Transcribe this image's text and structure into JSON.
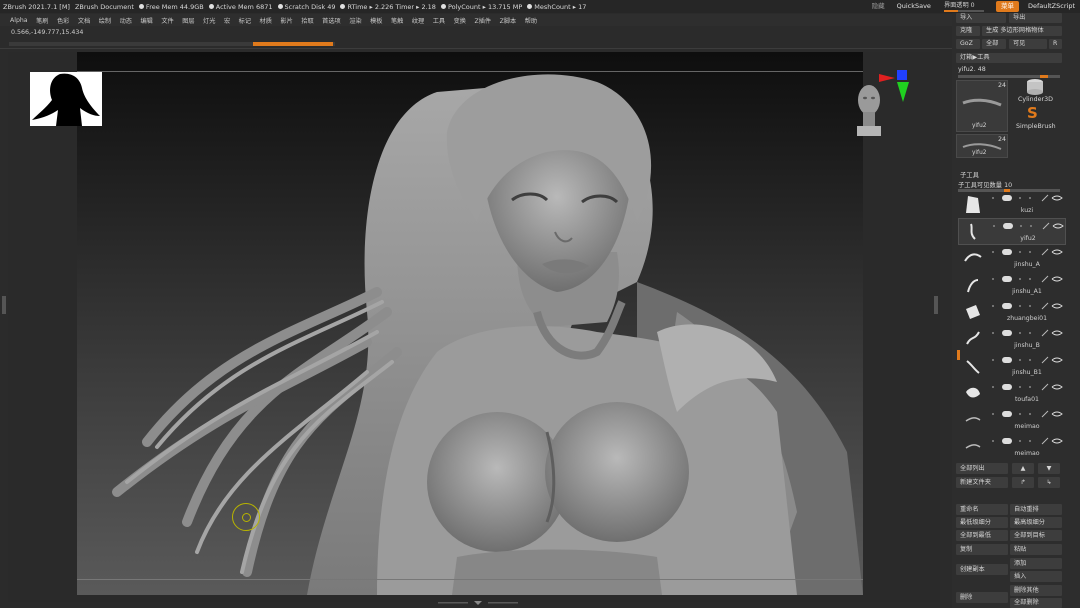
{
  "titlebar": {
    "app": "ZBrush 2021.7.1 [M]",
    "document": "ZBrush Document",
    "free_mem": "Free Mem 44.9GB",
    "active_mem": "Active Mem 6871",
    "scratch_disk": "Scratch Disk 49",
    "rtime": "RTime ▸ 2.226 Timer ▸ 2.18",
    "polycount": "PolyCount ▸ 13.715 MP",
    "meshcount": "MeshCount ▸ 17",
    "hidden_label": "隐藏",
    "quicksave": "QuickSave",
    "transparency": "界面透明 0",
    "menu_button": "菜单",
    "script": "DefaultZScript"
  },
  "menubar": {
    "items": [
      "Alpha",
      "笔刷",
      "色彩",
      "文档",
      "绘制",
      "动态",
      "编辑",
      "文件",
      "图层",
      "灯光",
      "宏",
      "标记",
      "材质",
      "影片",
      "拾取",
      "首选项",
      "渲染",
      "模板",
      "笔触",
      "纹理",
      "工具",
      "变换",
      "Z插件",
      "Z脚本",
      "帮助"
    ]
  },
  "viewport": {
    "coords": "0.566,-149.777,15.434",
    "progress": 0.25
  },
  "rpanel": {
    "import": "导入",
    "export": "导出",
    "clone": "克隆",
    "make_polymesh": "生成 多边形网格物体",
    "goz": "GoZ",
    "all": "全部",
    "visible": "可见",
    "r": "R",
    "lightbox_tool": "灯箱▶工具",
    "tool_name": "yifu2. 48",
    "thumb_a_label": "yifu2",
    "thumb_a_count": "24",
    "thumb_b_label": "yifu2",
    "thumb_b_count": "24",
    "cylinder": "Cylinder3D",
    "simplebrush": "SimpleBrush",
    "subtool_header": "子工具",
    "subtool_visible_count": "子工具可见数量 10",
    "subtools": [
      {
        "name": "kuzi"
      },
      {
        "name": "yifu2"
      },
      {
        "name": "jinshu_A"
      },
      {
        "name": "jinshu_A1"
      },
      {
        "name": "zhuangbei01"
      },
      {
        "name": "jinshu_B"
      },
      {
        "name": "jinshu_B1"
      },
      {
        "name": "toufa01"
      },
      {
        "name": "meimao"
      },
      {
        "name": "meimao"
      }
    ],
    "list_all": "全部列出",
    "new_folder": "新建文件夹",
    "rename": "重命名",
    "auto_reorder": "自动重排",
    "lowest_subdiv": "最低级细分",
    "highest_subdiv": "最高级细分",
    "all_to_lowest": "全部到最低",
    "all_to_target": "全部到目标",
    "copy": "复制",
    "paste": "粘贴",
    "create_instance": "创建副本",
    "add": "添加",
    "insert": "插入",
    "delete": "删除",
    "delete_other": "删除其他",
    "delete_all": "全部删除"
  }
}
